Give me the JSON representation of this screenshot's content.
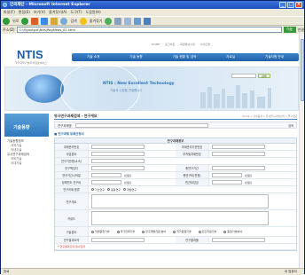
{
  "window": {
    "title": "인곡재단 - Microsoft Internet Explorer"
  },
  "menu": [
    "파일(F)",
    "편집(E)",
    "보기(V)",
    "즐겨찾기(A)",
    "도구(T)",
    "도움말(H)"
  ],
  "toolbar": {
    "back": "뒤로",
    "search": "검색",
    "favorites": "즐겨찾기"
  },
  "address": {
    "label": "주소(D)",
    "url": "C:\\Myoutput\\Ntis\\RegMeas_02.html",
    "go": "이동",
    "links": "연결"
  },
  "site": {
    "topnav": [
      "HOME",
      "로그아웃",
      "회원정보수정",
      "사이트맵"
    ],
    "logo": "NTIS",
    "logo_sub": "국가과학기술지식정보서비스",
    "gnb": [
      "기술 소개",
      "기술 동향",
      "기술 현황 및 검색",
      "자료실",
      "기술지원 안내"
    ],
    "slogan": "NTIS : New Excellent Technology",
    "slogan2": "기술과 시장을 연결합니다",
    "login_btn": "검색"
  },
  "lnb": {
    "title": "기술동향",
    "items": [
      {
        "label": "기술동향정보",
        "sub": false
      },
      {
        "label": "국외기술",
        "sub": true
      },
      {
        "label": "국내기술",
        "sub": true
      },
      {
        "label": "유사연구과제검색",
        "sub": false
      },
      {
        "label": "국외기술",
        "sub": true
      },
      {
        "label": "국내기술",
        "sub": true
      }
    ]
  },
  "main": {
    "title": "유사연구과제검색 - 연구개요",
    "breadcrumb": "Home > 기술동향 > 유사연구과제검색 > 연구개요",
    "search_label": "연구과제명",
    "search_btn": "검색",
    "section": "■ 연구과제 등록신청서",
    "form_head": "연구과제정보",
    "rows": [
      {
        "l1": "과제관리번호",
        "l2": "과제관리기관번호"
      },
      {
        "l1": "사업분야",
        "l2": "부처및과제번호"
      },
      {
        "l1": "연구기관명(소속)",
        "l2": ""
      },
      {
        "l1": "연구책임자",
        "l2": "총연구기간"
      },
      {
        "l1": "연구기간시작일",
        "l2": "총연구비(천원)"
      },
      {
        "l1": "당해연도 연구비",
        "l2": "민간부담금"
      }
    ],
    "unit": "(만원)",
    "period_label": "연구과제 종류",
    "period_opts": [
      "기초연구",
      "응용연구",
      "개발연구"
    ],
    "summary_label": "연구개요",
    "keyword_label": "키워드",
    "field_label": "기술분야",
    "field_opts": [
      "미래원천기술",
      "국가전략기술",
      "연구개발지원 분야",
      "국가중점기술",
      "민간지원기술",
      "중점기술분야"
    ],
    "result_label": "연구결과요약",
    "result_label2": "연구결과물",
    "note": "* 연구결과요약 필수입력"
  },
  "status": {
    "left": "완료",
    "right": "내 컴퓨터"
  }
}
